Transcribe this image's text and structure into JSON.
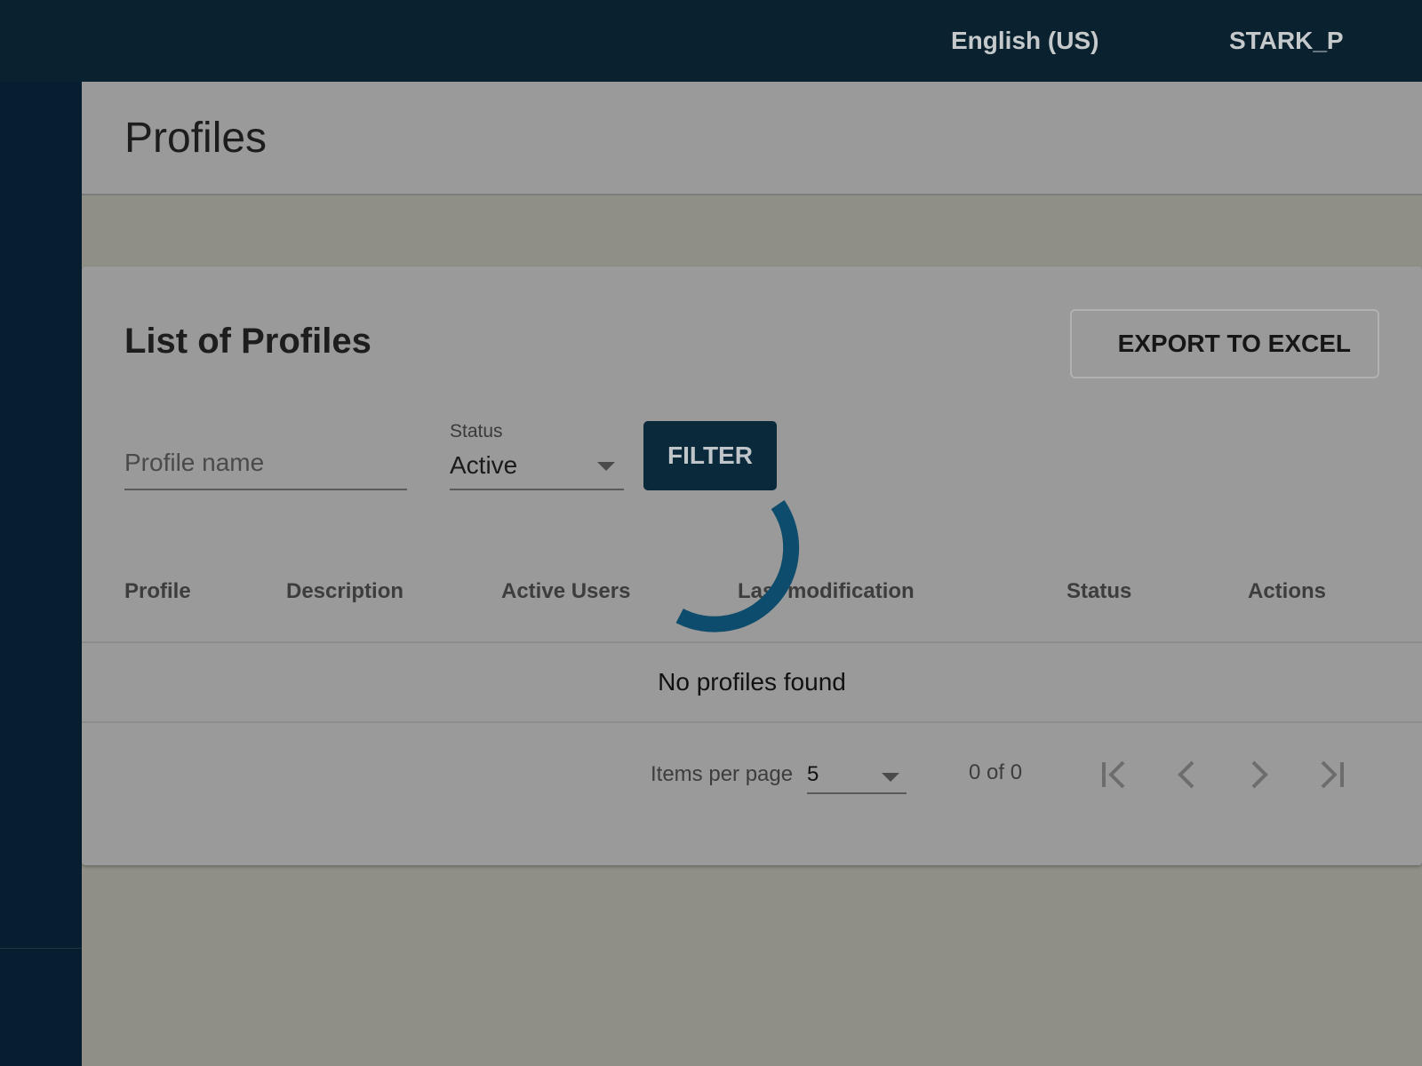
{
  "topbar": {
    "language": "English (US)",
    "user": "STARK_P"
  },
  "page": {
    "title": "Profiles"
  },
  "card": {
    "title": "List of Profiles",
    "export_label": "EXPORT TO EXCEL"
  },
  "filters": {
    "profile_name_placeholder": "Profile name",
    "profile_name_value": "",
    "status_label": "Status",
    "status_value": "Active",
    "filter_label": "FILTER"
  },
  "table": {
    "columns": [
      "Profile",
      "Description",
      "Active Users",
      "Last modification",
      "Status",
      "Actions"
    ],
    "rows": [],
    "empty_message": "No profiles found"
  },
  "pagination": {
    "items_per_page_label": "Items per page",
    "items_per_page_value": "5",
    "range": "0 of 0"
  },
  "icons": {
    "language": "globe-icon",
    "loading": "loading-spinner-icon",
    "first_page": "first-page-icon",
    "prev_page": "chevron-left-icon",
    "next_page": "chevron-right-icon",
    "last_page": "last-page-icon"
  },
  "colors": {
    "topbar": "#0a222f",
    "sidebar": "#061e2f",
    "primary_button": "#0a2a3c",
    "spinner": "#0d4c6c"
  }
}
